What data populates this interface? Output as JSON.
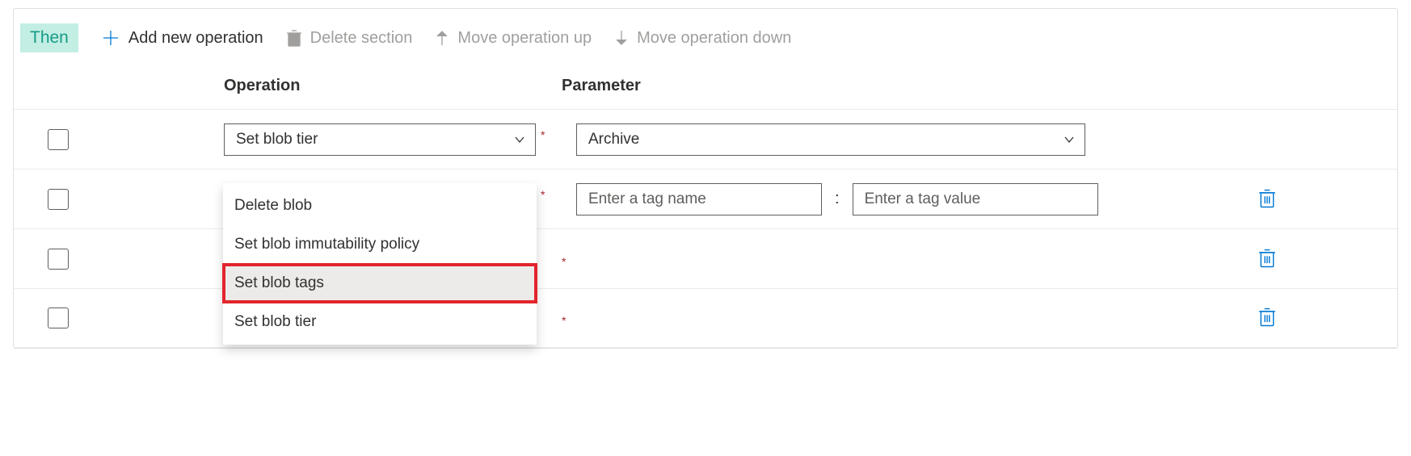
{
  "toolbar": {
    "then_label": "Then",
    "add_label": "Add new operation",
    "delete_section_label": "Delete section",
    "move_up_label": "Move operation up",
    "move_down_label": "Move operation down"
  },
  "headers": {
    "operation": "Operation",
    "parameter": "Parameter"
  },
  "rows": [
    {
      "operation": "Set blob tier",
      "param_mode": "dropdown",
      "param_value": "Archive",
      "show_delete": false
    },
    {
      "operation": "Set blob tags",
      "param_mode": "tag",
      "tag_name_placeholder": "Enter a tag name",
      "tag_value_placeholder": "Enter a tag value",
      "show_delete": true
    },
    {
      "operation": "",
      "param_mode": "none",
      "show_delete": true
    },
    {
      "operation": "",
      "param_mode": "none",
      "show_delete": true
    }
  ],
  "dropdown_options": [
    {
      "label": "Delete blob",
      "selected": false,
      "highlighted": false
    },
    {
      "label": "Set blob immutability policy",
      "selected": false,
      "highlighted": false
    },
    {
      "label": "Set blob tags",
      "selected": true,
      "highlighted": true
    },
    {
      "label": "Set blob tier",
      "selected": false,
      "highlighted": false
    }
  ],
  "colors": {
    "accent": "#0078d4",
    "then_bg": "#c3eee4",
    "then_fg": "#169b87",
    "highlight": "#e3242b"
  },
  "misc": {
    "colon": ":"
  }
}
